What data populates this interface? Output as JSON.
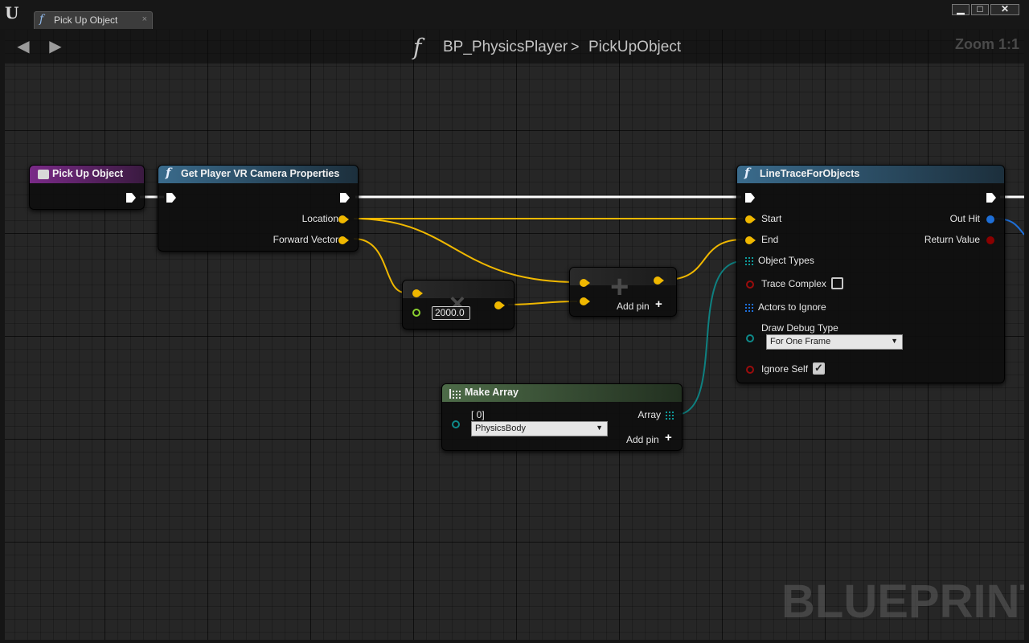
{
  "window": {
    "tab_label": "Pick Up Object",
    "tab_close": "×",
    "minimize": "▁",
    "maximize": "□",
    "close": "✕"
  },
  "toolbar": {
    "back_icon": "arrow-left-icon",
    "forward_icon": "arrow-right-icon",
    "breadcrumb": [
      "BP_PhysicsPlayer",
      "PickUpObject"
    ],
    "separator": ">",
    "zoom": "Zoom 1:1"
  },
  "watermark": "BLUEPRINT",
  "nodes": {
    "entry": {
      "title": "Pick Up Object",
      "header_color": "#7a2a88"
    },
    "camera": {
      "title": "Get Player VR Camera Properties",
      "header_color": "#3a6b8c",
      "outputs": [
        "Location",
        "Forward Vector"
      ]
    },
    "multiply": {
      "operator": "×",
      "value": "2000.0"
    },
    "add": {
      "operator": "+",
      "add_pin_label": "Add pin",
      "add_pin_icon": "+"
    },
    "trace": {
      "title": "LineTraceForObjects",
      "header_color": "#3a6b8c",
      "inputs": {
        "start": "Start",
        "end": "End",
        "object_types": "Object Types",
        "trace_complex": "Trace Complex",
        "actors_to_ignore": "Actors to Ignore",
        "draw_debug_type": "Draw Debug Type",
        "draw_debug_value": "For One Frame",
        "ignore_self": "Ignore Self"
      },
      "outputs": {
        "out_hit": "Out Hit",
        "return_value": "Return Value"
      },
      "trace_complex_checked": false,
      "ignore_self_checked": true
    },
    "make_array": {
      "title": "Make Array",
      "header_color": "#4d6b48",
      "index_label": "[ 0]",
      "element_value": "PhysicsBody",
      "output_label": "Array",
      "add_pin_label": "Add pin",
      "add_pin_icon": "+"
    }
  },
  "colors": {
    "exec_wire": "#ffffff",
    "vector_wire": "#f0b800",
    "object_type_wire": "#0e8080",
    "hit_result_wire": "#1e6fd8"
  }
}
